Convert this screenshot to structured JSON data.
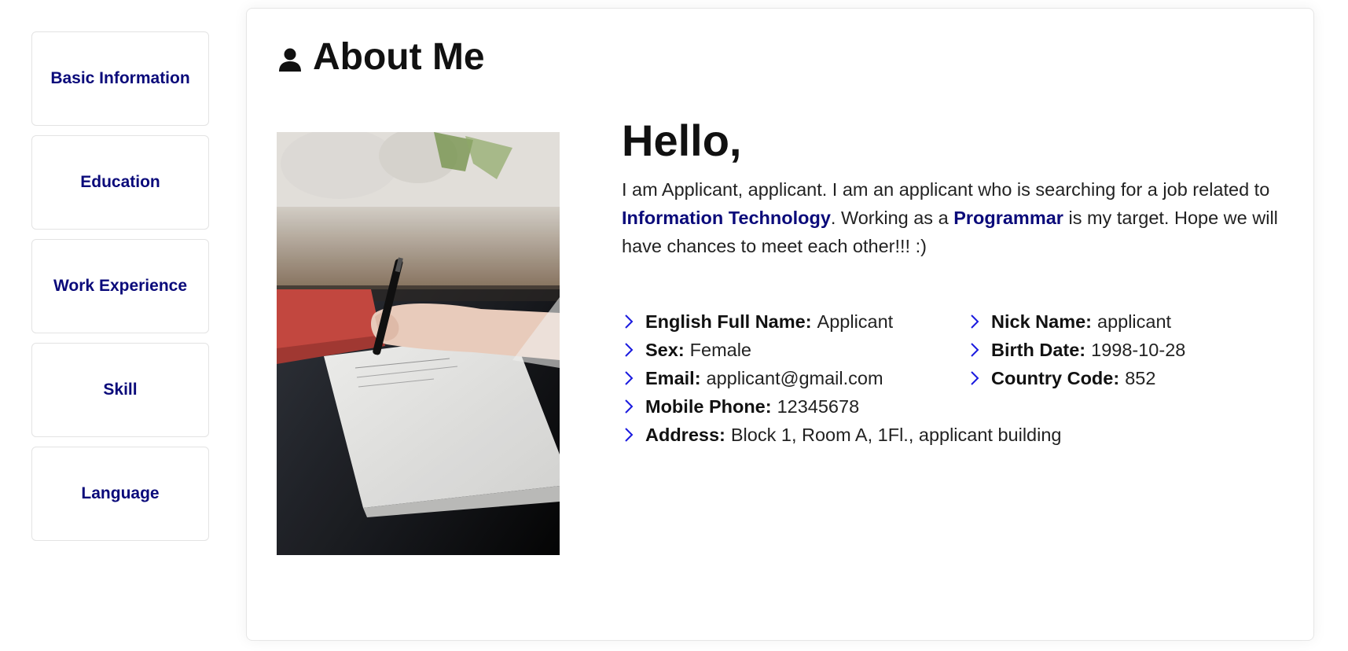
{
  "sidebar": {
    "items": [
      {
        "label": "Basic Information"
      },
      {
        "label": "Education"
      },
      {
        "label": "Work Experience"
      },
      {
        "label": "Skill"
      },
      {
        "label": "Language"
      }
    ]
  },
  "main": {
    "title": "About Me",
    "title_icon": "person-icon",
    "greeting": "Hello,",
    "intro": {
      "part1": "I am Applicant, applicant. I am an applicant who is searching for a job related to ",
      "highlight1": "Information Technology",
      "part2": ". Working as a ",
      "highlight2": "Programmar",
      "part3": " is my target. Hope we will have chances to meet each other!!! :)"
    },
    "info_left": [
      {
        "label": "English Full Name:",
        "value": "Applicant"
      },
      {
        "label": "Sex:",
        "value": "Female"
      },
      {
        "label": "Email:",
        "value": "applicant@gmail.com"
      },
      {
        "label": "Mobile Phone:",
        "value": "12345678"
      },
      {
        "label": "Address:",
        "value": "Block 1, Room A, 1Fl., applicant building"
      }
    ],
    "info_right": [
      {
        "label": "Nick Name:",
        "value": "applicant"
      },
      {
        "label": "Birth Date:",
        "value": "1998-10-28"
      },
      {
        "label": "Country Code:",
        "value": "852"
      }
    ]
  },
  "colors": {
    "accent": "#0a0a7a",
    "chevron": "#1a1adf"
  }
}
